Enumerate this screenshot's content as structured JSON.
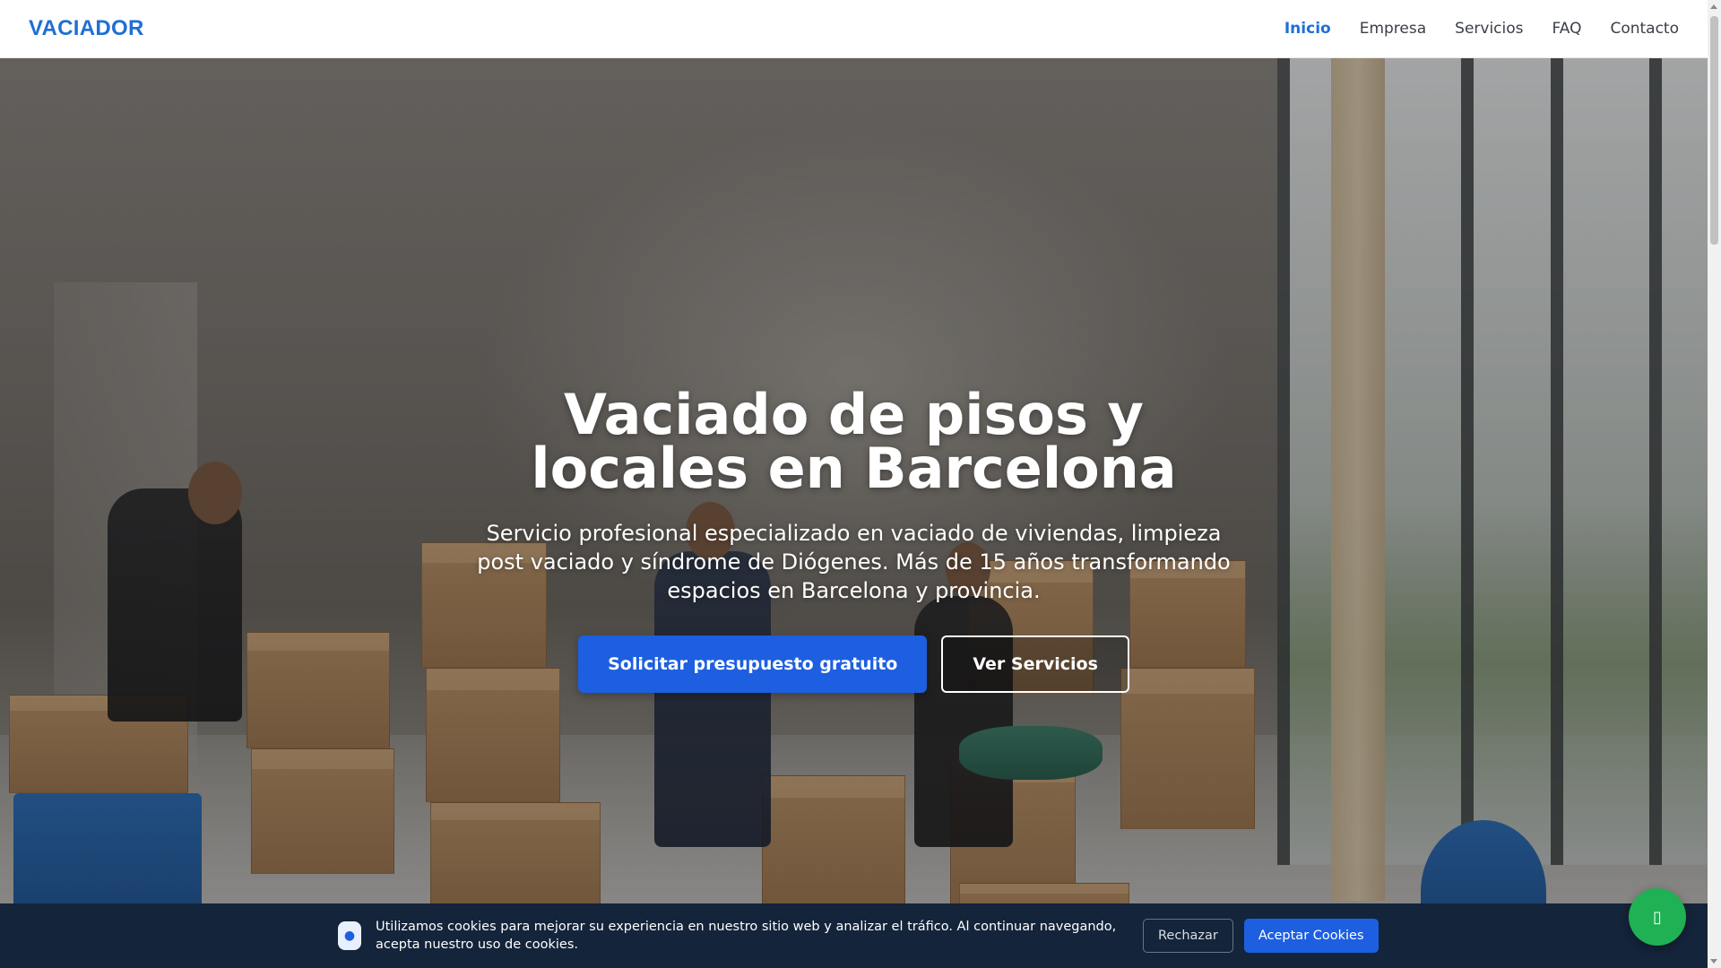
{
  "header": {
    "logo": "VACIADOR",
    "nav": [
      {
        "label": "Inicio",
        "active": true
      },
      {
        "label": "Empresa",
        "active": false
      },
      {
        "label": "Servicios",
        "active": false
      },
      {
        "label": "FAQ",
        "active": false
      },
      {
        "label": "Contacto",
        "active": false
      }
    ]
  },
  "hero": {
    "title": "Vaciado de pisos y locales en Barcelona",
    "subtitle": "Servicio profesional especializado en vaciado de viviendas, limpieza post vaciado y síndrome de Diógenes. Más de 15 años transformando espacios en Barcelona y provincia.",
    "primary_button": "Solicitar presupuesto gratuito",
    "secondary_button": "Ver Servicios",
    "background_image": "workers-moving-boxes-empty-room-photo"
  },
  "cookie_banner": {
    "icon": "cookie-icon",
    "text": "Utilizamos cookies para mejorar su experiencia en nuestro sitio web y analizar el tráfico. Al continuar navegando, acepta nuestro uso de cookies.",
    "reject_label": "Rechazar",
    "accept_label": "Aceptar Cookies"
  },
  "floating": {
    "whatsapp_icon": "whatsapp-icon"
  },
  "colors": {
    "brand": "#1f6fd6",
    "primary_button": "#1d5fe0",
    "cookie_bg": "#14243a",
    "whatsapp": "#1fb153"
  }
}
